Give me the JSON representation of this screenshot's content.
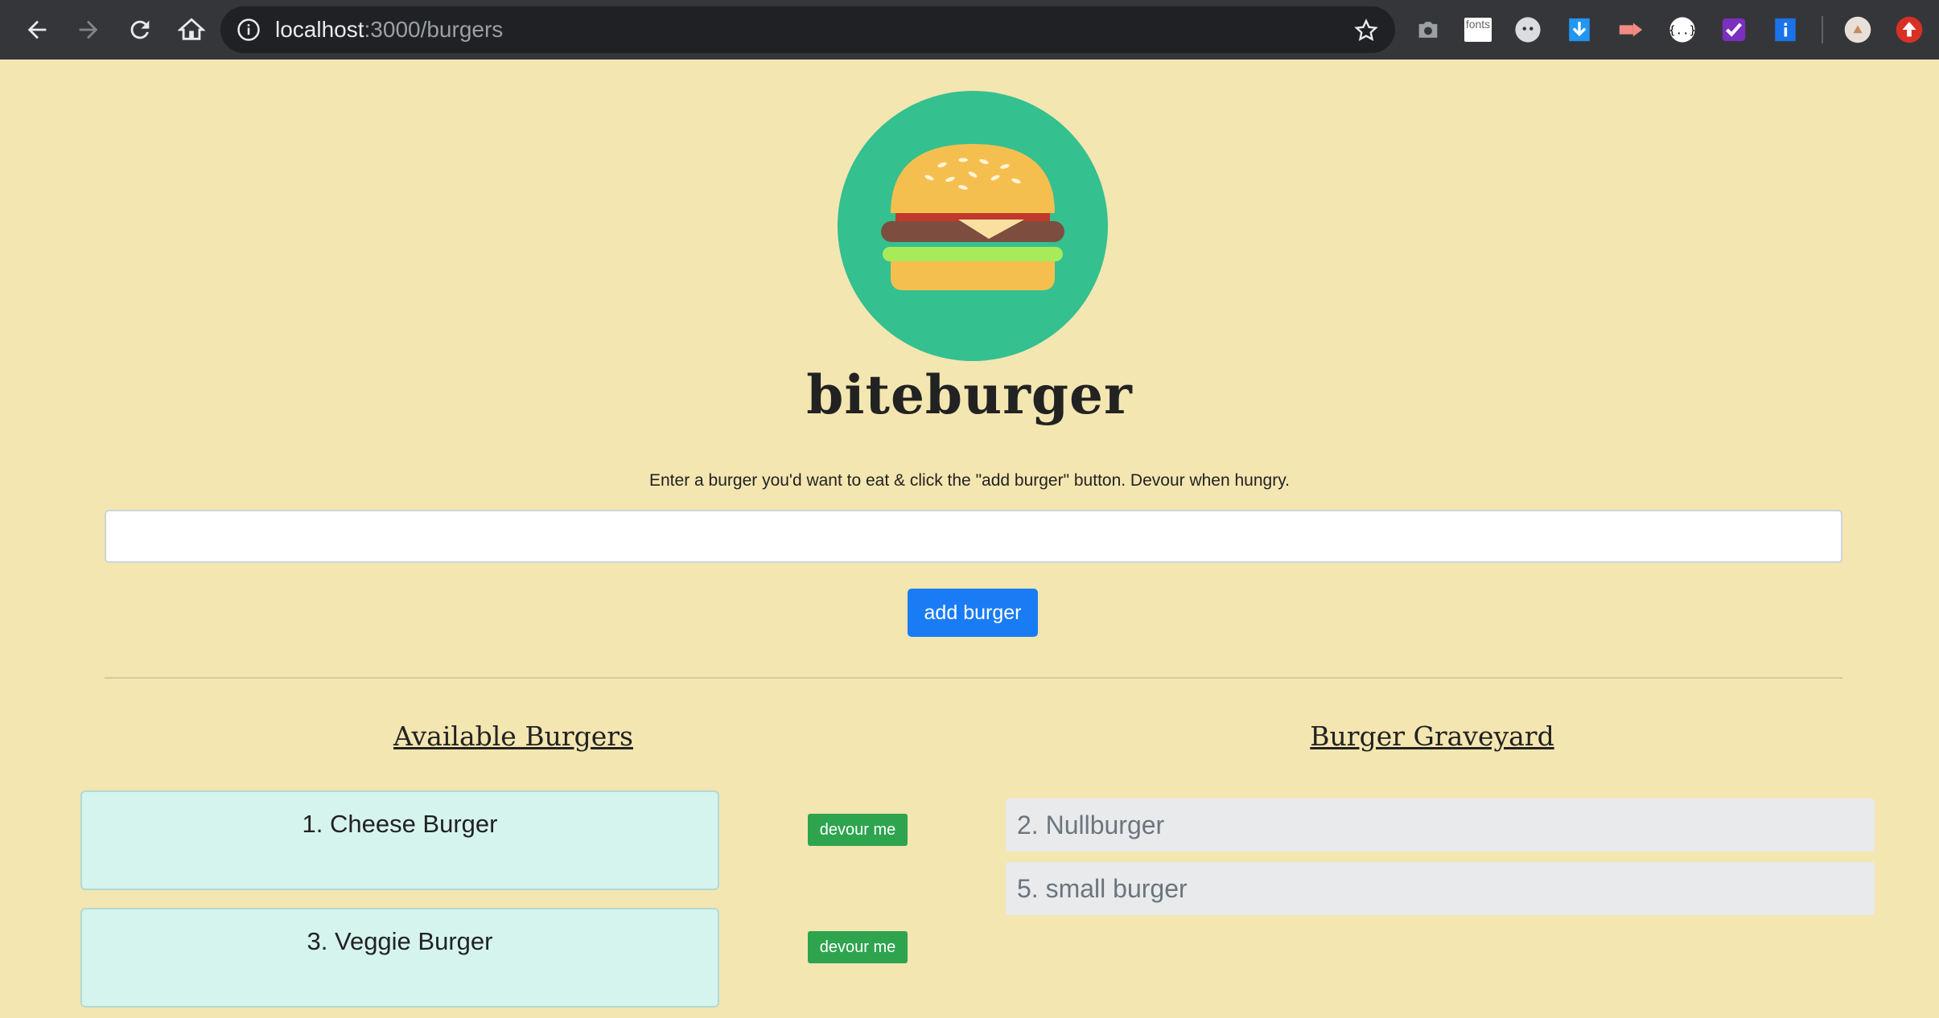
{
  "browser": {
    "url_host": "localhost",
    "url_path": ":3000/burgers",
    "nav": [
      "back-icon",
      "forward-icon",
      "reload-icon",
      "home-icon"
    ],
    "extensions": [
      {
        "name": "camera-extension-icon",
        "color": "#9aa0a6"
      },
      {
        "name": "fonts-extension-icon",
        "label": "fonts",
        "color": "#ffffff"
      },
      {
        "name": "ghost-extension-icon",
        "color": "#dadce0"
      },
      {
        "name": "download-extension-icon",
        "color": "#2196f3"
      },
      {
        "name": "video-extension-icon",
        "color": "#f28b82"
      },
      {
        "name": "json-extension-icon",
        "color": "#ffffff"
      },
      {
        "name": "check-extension-icon",
        "color": "#7b2fbe"
      },
      {
        "name": "info-extension-icon",
        "color": "#1a73e8"
      },
      {
        "name": "avatar-icon",
        "color": "#e8e0d8"
      },
      {
        "name": "update-icon",
        "color": "#d93025"
      }
    ]
  },
  "header": {
    "brand": "biteburger",
    "instructions": "Enter a burger you'd want to eat & click the \"add burger\" button. Devour when hungry."
  },
  "form": {
    "input_value": "",
    "add_label": "add burger"
  },
  "columns": {
    "available_title": "Available Burgers",
    "graveyard_title": "Burger Graveyard"
  },
  "available": [
    {
      "label": "1. Cheese Burger",
      "action": "devour me"
    },
    {
      "label": "3. Veggie Burger",
      "action": "devour me"
    }
  ],
  "graveyard": [
    {
      "label": "2. Nullburger"
    },
    {
      "label": "5. small burger"
    }
  ],
  "colors": {
    "page_bg": "#f3e6b1",
    "logo_circle": "#34c08f",
    "primary": "#1a7cf5",
    "success": "#2ea44f",
    "card_bg": "#d5f4ee"
  }
}
